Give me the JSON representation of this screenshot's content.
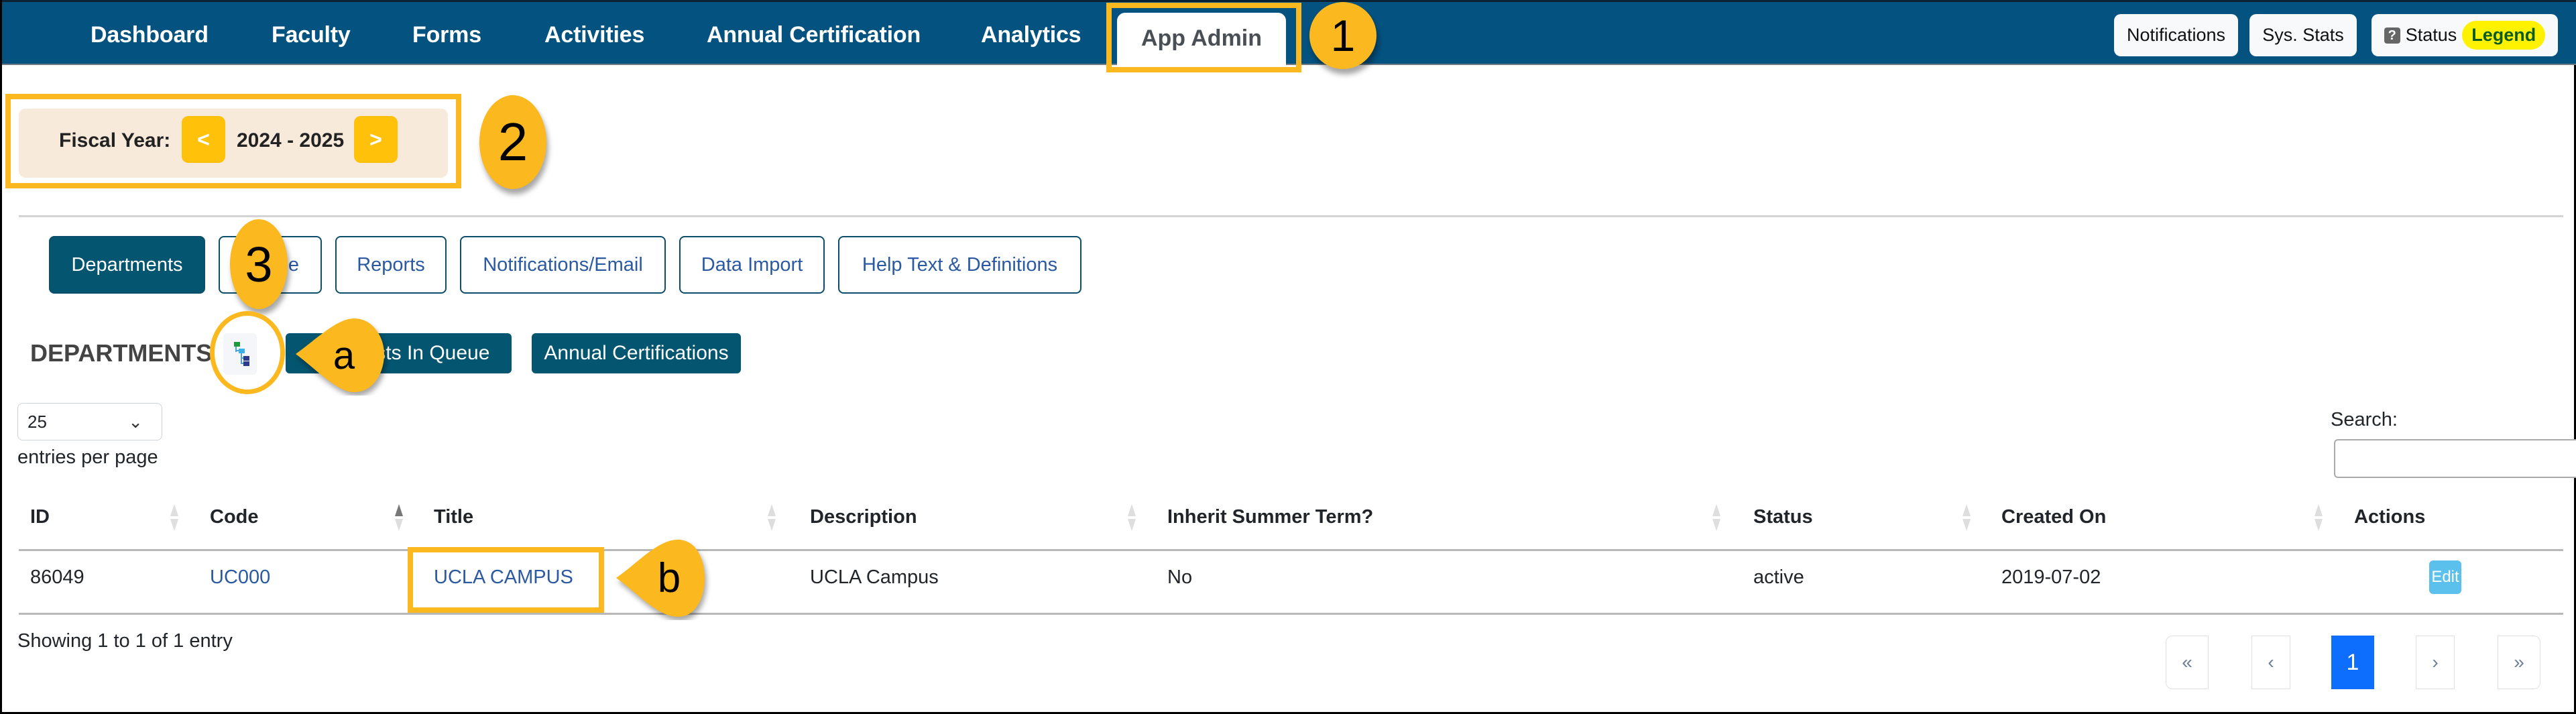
{
  "nav": {
    "items": [
      {
        "label": "Dashboard"
      },
      {
        "label": "Faculty"
      },
      {
        "label": "Forms"
      },
      {
        "label": "Activities"
      },
      {
        "label": "Annual Certification"
      },
      {
        "label": "Analytics"
      },
      {
        "label": "App Admin",
        "active": true
      }
    ],
    "right_buttons": {
      "notifications": "Notifications",
      "sys_stats": "Sys. Stats",
      "status": "Status",
      "status_icon": "?",
      "legend": "Legend"
    }
  },
  "fiscal_year": {
    "label": "Fiscal Year:",
    "prev": "<",
    "value": "2024 - 2025",
    "next": ">"
  },
  "tabs": [
    {
      "label": "Departments",
      "active": true
    },
    {
      "label": "e"
    },
    {
      "label": "Reports"
    },
    {
      "label": "Notifications/Email"
    },
    {
      "label": "Data Import"
    },
    {
      "label": "Help Text & Definitions"
    }
  ],
  "section": {
    "title": "DEPARTMENTS",
    "tree_icon": "org-tree-icon",
    "queue_button": "A        ests In Queue",
    "annual_cert_button": "Annual Certifications"
  },
  "table_controls": {
    "page_size": "25",
    "page_size_chevron": "⌄",
    "entries_per_page": "entries per page",
    "search_label": "Search:",
    "search_value": ""
  },
  "table": {
    "columns": [
      "ID",
      "Code",
      "Title",
      "Description",
      "Inherit Summer Term?",
      "Status",
      "Created On",
      "Actions"
    ],
    "sorted_column": "Code",
    "rows": [
      {
        "id": "86049",
        "code": "UC000",
        "title": "UCLA CAMPUS",
        "description": "UCLA Campus",
        "inherit_summer_term": "No",
        "status": "active",
        "created_on": "2019-07-02",
        "action": "Edit"
      }
    ]
  },
  "footer": {
    "showing": "Showing 1 to 1 of 1 entry",
    "pagination": {
      "first": "«",
      "prev": "‹",
      "current": "1",
      "next": "›",
      "last": "»"
    }
  },
  "annotations": {
    "c1": "1",
    "c2": "2",
    "c3": "3",
    "ca": "a",
    "cb": "b",
    "color": "#fbb81f"
  }
}
